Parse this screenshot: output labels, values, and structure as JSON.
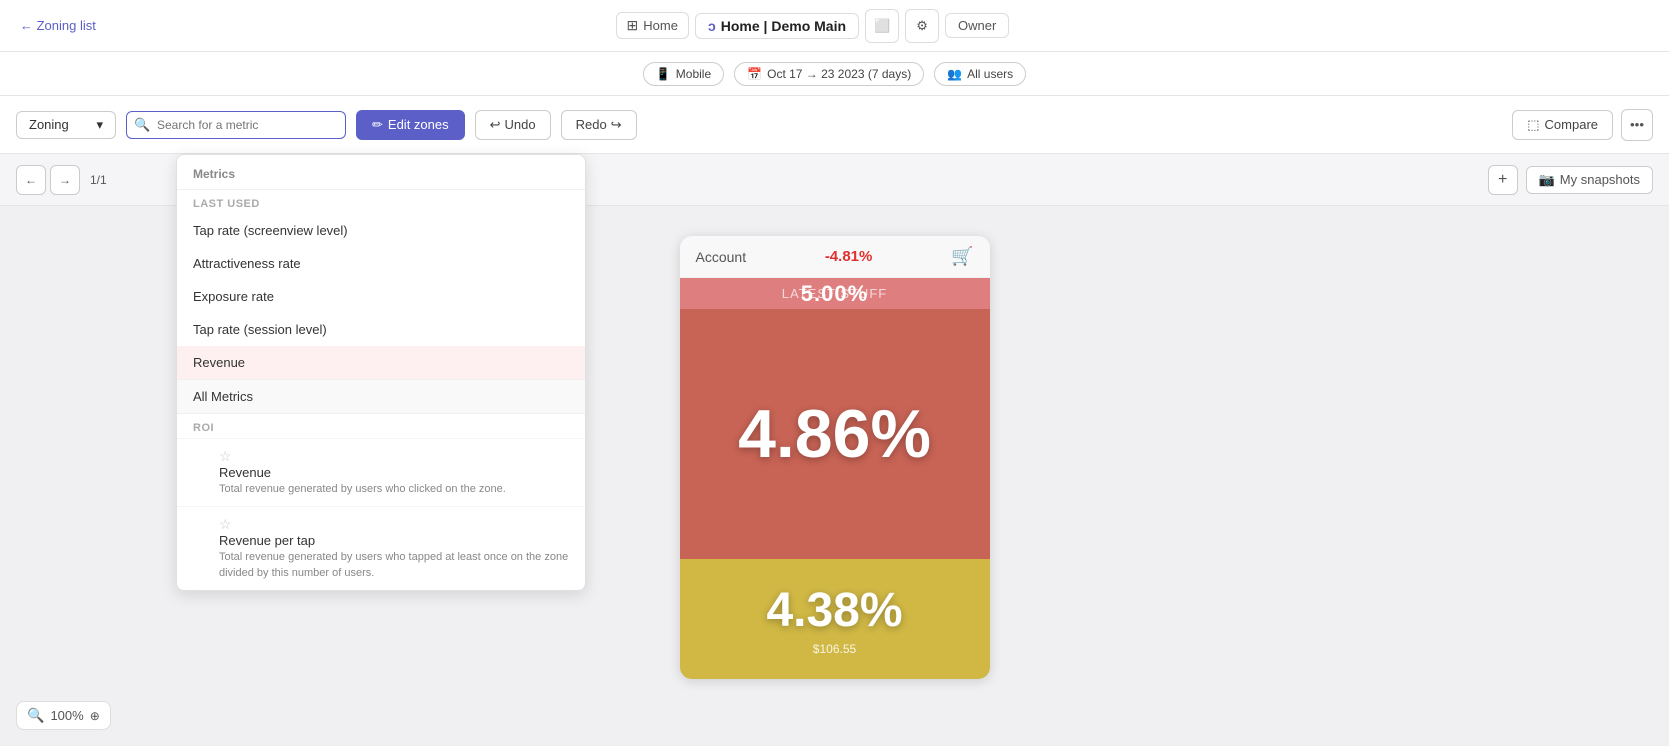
{
  "nav": {
    "back_label": "← Zoning list",
    "home_label": "Home",
    "active_label": "Home | Demo Main",
    "owner_label": "Owner"
  },
  "filters": {
    "device": "Mobile",
    "date_range": "Oct 17 → 23 2023 (7 days)",
    "users": "All users"
  },
  "toolbar": {
    "dropdown_label": "Zoning",
    "search_placeholder": "Search for a metric",
    "edit_label": "Edit zones",
    "undo_label": "Undo",
    "redo_label": "Redo",
    "compare_label": "Compare"
  },
  "pagination": {
    "prev": "←",
    "next": "→",
    "current": "1/1"
  },
  "snapshots": {
    "add_label": "+",
    "my_snapshots_label": "My snapshots"
  },
  "dropdown_menu": {
    "header": "Metrics",
    "last_used_label": "Last Used",
    "items_last_used": [
      "Tap rate (screenview level)",
      "Attractiveness rate",
      "Exposure rate",
      "Tap rate (session level)",
      "Revenue"
    ],
    "all_metrics_label": "All Metrics",
    "roi_section_label": "ROI",
    "roi_items": [
      {
        "name": "Revenue",
        "desc": "Total revenue generated by users who clicked on the zone.",
        "starred": false
      },
      {
        "name": "Revenue per tap",
        "desc": "Total revenue generated by users who tapped at least once on the zone divided by this number of users.",
        "starred": false
      }
    ]
  },
  "phone": {
    "header_account": "Account",
    "header_pct": "-4.81%",
    "latest_stuff": "LATEST STUFF",
    "zone1_pct": "5.00%",
    "zone2_pct": "4.86%",
    "zone3_pct": "4.38%",
    "bottom_price": "$106.55"
  },
  "zoom": {
    "level": "100%"
  }
}
